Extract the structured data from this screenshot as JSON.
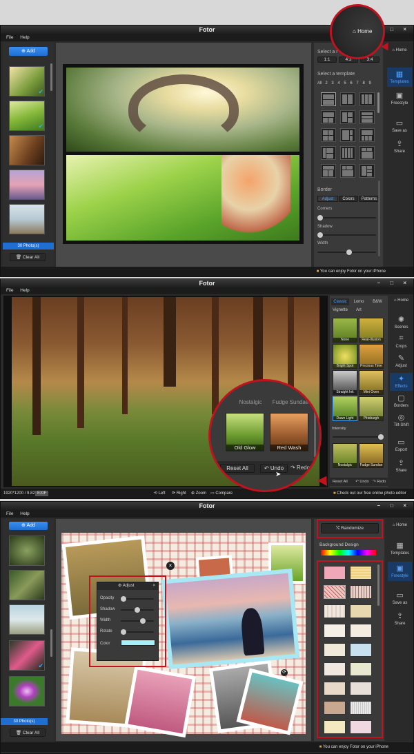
{
  "s1": {
    "title": "Fotor",
    "menu": [
      "File",
      "Help"
    ],
    "add_label": "Add",
    "photo_count": "30 Photo(s)",
    "clear_all": "Clear All",
    "select_ratio": "Select a r",
    "ratios": [
      "1:1",
      "4:3",
      "3:4"
    ],
    "select_template": "Select a template",
    "template_tabs": [
      "All",
      "2",
      "3",
      "4",
      "5",
      "6",
      "7",
      "8",
      "9"
    ],
    "border_label": "Border",
    "border_tabs": [
      "Adjust",
      "Colors",
      "Patterns"
    ],
    "sliders": [
      "Corners",
      "Shadow",
      "Width"
    ],
    "nav": [
      "Home",
      "Templates",
      "Freestyle",
      "Save as",
      "Share"
    ],
    "status": "You can enjoy Fotor on your iPhone"
  },
  "s2": {
    "title": "Fotor",
    "menu": [
      "File",
      "Help"
    ],
    "tabs": [
      "Classic",
      "Lomo",
      "B&W",
      "Vignette",
      "Art"
    ],
    "effects": [
      "None",
      "Real-Illusion",
      "Bright Spot",
      "Precious Time",
      "Straight Ink",
      "Mini Oven",
      "Dawn Light",
      "Pittsburgh",
      "Nostalgic",
      "Fudge Sundae"
    ],
    "intensity": "Intensity",
    "reset_all": "Reset All",
    "undo": "Undo",
    "redo": "Redo",
    "zoom_effects": [
      "Nostalgic",
      "Fudge Sundae",
      "Old Glow",
      "Red Wash"
    ],
    "nav": [
      "Home",
      "Scenes",
      "Crops",
      "Adjust",
      "Effects",
      "Borders",
      "Tilt-Shift",
      "Export",
      "Share"
    ],
    "file_info": "1920*1200 / 9.82MB",
    "exif": "EXIF",
    "tools": [
      "Left",
      "Right",
      "Zoom",
      "Compare"
    ],
    "status": "Check out our free online photo editor"
  },
  "s3": {
    "title": "Fotor",
    "menu": [
      "File",
      "Help"
    ],
    "add_label": "Add",
    "photo_count": "30 Photo(s)",
    "clear_all": "Clear All",
    "randomize": "Randomize",
    "bg_design": "Background Design",
    "adjust_title": "Adjust",
    "adjust_rows": [
      "Opacity",
      "Shadow",
      "Width",
      "Rotate",
      "Color"
    ],
    "nav": [
      "Home",
      "Templates",
      "Freestyle",
      "Save as",
      "Share"
    ],
    "status": "You can enjoy Fotor on your iPhone"
  },
  "colors": {
    "accent_blue": "#2f86ea",
    "highlight_red": "#c1121f"
  }
}
